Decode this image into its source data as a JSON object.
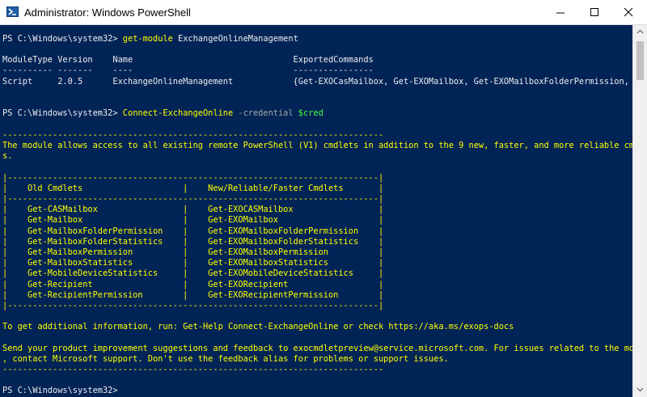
{
  "window": {
    "title": "Administrator: Windows PowerShell",
    "icon": "powershell-icon",
    "controls": [
      "minimize-icon",
      "maximize-icon",
      "close-icon"
    ]
  },
  "colors": {
    "background": "#012456",
    "text": "#eeedf0",
    "highlight": "#ffff00",
    "parameter": "#a8a8a8",
    "variable": "#40ff40"
  },
  "console": {
    "cmd1": {
      "prompt": "PS C:\\Windows\\system32> ",
      "command": "get-module",
      "args": " ExchangeOnlineManagement"
    },
    "table": {
      "header": "ModuleType Version    Name                                ExportedCommands",
      "divider": "---------- -------    ----                                ----------------",
      "row": "Script     2.0.5      ExchangeOnlineManagement            {Get-EXOCasMailbox, Get-EXOMailbox, Get-EXOMailboxFolderPermission, ..."
    },
    "cmd2": {
      "prompt": "PS C:\\Windows\\system32> ",
      "command": "Connect-ExchangeOnline",
      "param": " -credential",
      "var": " $cred"
    },
    "banner": {
      "rule": "----------------------------------------------------------------------------",
      "message_1": "The module allows access to all existing remote PowerShell (V1) cmdlets in addition to the 9 new, faster, and more reliable cmdlet",
      "message_2": "s.",
      "box_top": "|--------------------------------------------------------------------------|",
      "box_header": "|    Old Cmdlets                    |    New/Reliable/Faster Cmdlets       |",
      "box_divider": "|--------------------------------------------------------------------------|",
      "box_rows": [
        "|    Get-CASMailbox                 |    Get-EXOCASMailbox                 |",
        "|    Get-Mailbox                    |    Get-EXOMailbox                    |",
        "|    Get-MailboxFolderPermission    |    Get-EXOMailboxFolderPermission    |",
        "|    Get-MailboxFolderStatistics    |    Get-EXOMailboxFolderStatistics    |",
        "|    Get-MailboxPermission          |    Get-EXOMailboxPermission          |",
        "|    Get-MailboxStatistics          |    Get-EXOMailboxStatistics          |",
        "|    Get-MobileDeviceStatistics     |    Get-EXOMobileDeviceStatistics     |",
        "|    Get-Recipient                  |    Get-EXORecipient                  |",
        "|    Get-RecipientPermission        |    Get-EXORecipientPermission        |"
      ],
      "box_bottom": "|--------------------------------------------------------------------------|",
      "info": "To get additional information, run: Get-Help Connect-ExchangeOnline or check https://aka.ms/exops-docs",
      "feedback_1": "Send your product improvement suggestions and feedback to exocmdletpreview@service.microsoft.com. For issues related to the module",
      "feedback_2": ", contact Microsoft support. Don't use the feedback alias for problems or support issues.",
      "rule_end": "----------------------------------------------------------------------------"
    },
    "final_prompt": "PS C:\\Windows\\system32> "
  }
}
